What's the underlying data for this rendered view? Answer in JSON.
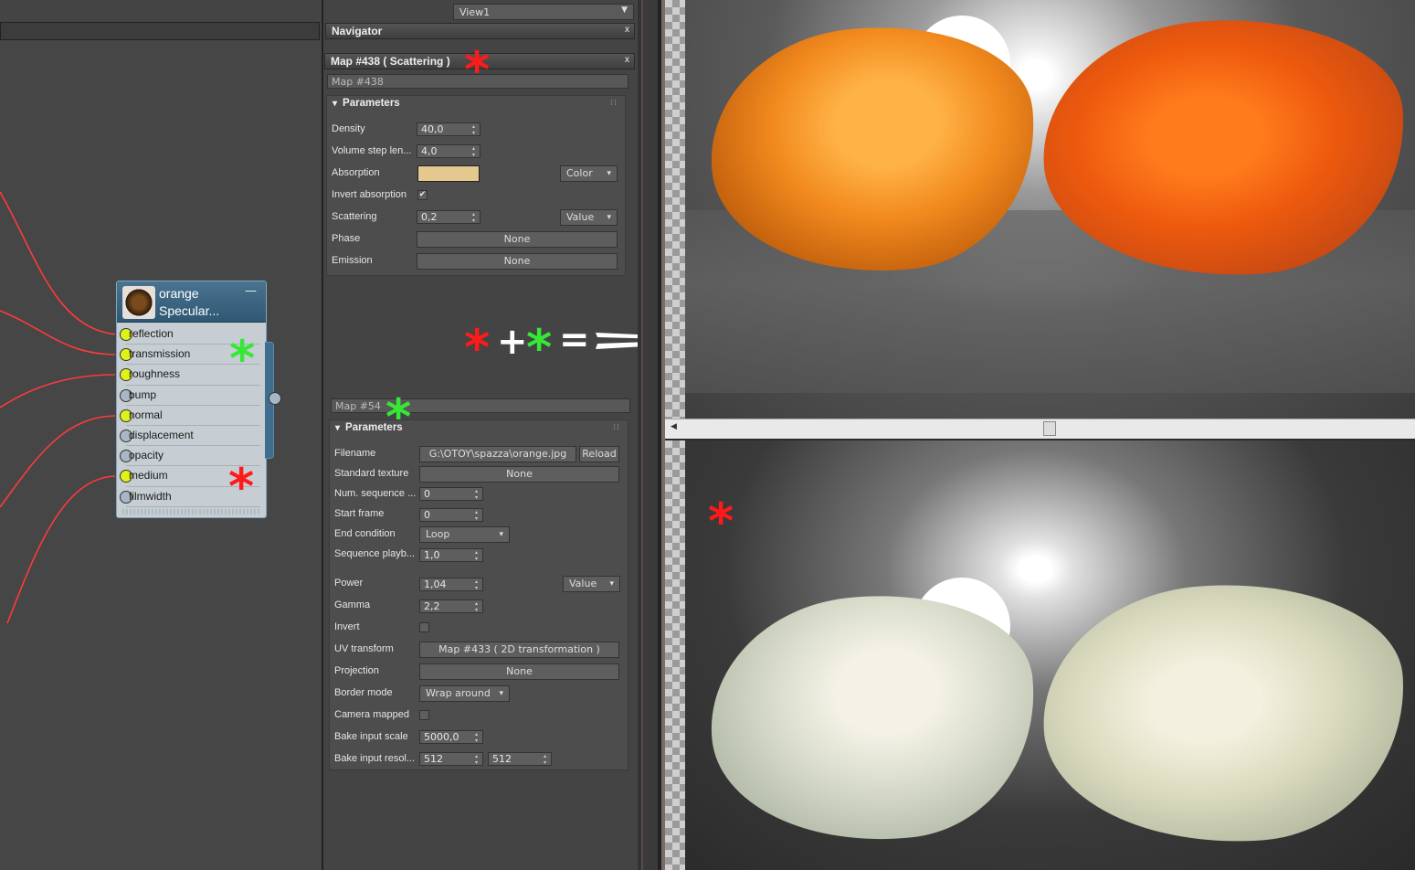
{
  "view_selector": {
    "value": "View1"
  },
  "navigator": {
    "title": "Navigator",
    "close": "x"
  },
  "scattering_panel": {
    "title": "Map #438  ( Scattering )",
    "close": "x",
    "name": "Map #438",
    "section": "Parameters",
    "params": {
      "density": {
        "label": "Density",
        "value": "40,0"
      },
      "volume_step": {
        "label": "Volume step len...",
        "value": "4,0"
      },
      "absorption": {
        "label": "Absorption",
        "color": "#e5c88e",
        "mode": "Color"
      },
      "invert_absorption": {
        "label": "Invert absorption",
        "checked": "✔"
      },
      "scattering": {
        "label": "Scattering",
        "value": "0,2",
        "mode": "Value"
      },
      "phase": {
        "label": "Phase",
        "value": "None"
      },
      "emission": {
        "label": "Emission",
        "value": "None"
      }
    }
  },
  "image_panel": {
    "name": "Map #54",
    "section": "Parameters",
    "params": {
      "filename": {
        "label": "Filename",
        "value": "G:\\OTOY\\spazza\\orange.jpg",
        "reload": "Reload"
      },
      "standard_texture": {
        "label": "Standard texture",
        "value": "None"
      },
      "num_sequence": {
        "label": "Num. sequence ...",
        "value": "0"
      },
      "start_frame": {
        "label": "Start frame",
        "value": "0"
      },
      "end_condition": {
        "label": "End condition",
        "value": "Loop"
      },
      "sequence_playback": {
        "label": "Sequence playb...",
        "value": "1,0"
      },
      "power": {
        "label": "Power",
        "value": "1,04",
        "mode": "Value"
      },
      "gamma": {
        "label": "Gamma",
        "value": "2,2"
      },
      "invert": {
        "label": "Invert"
      },
      "uv_transform": {
        "label": "UV transform",
        "value": "Map #433  ( 2D transformation )"
      },
      "projection": {
        "label": "Projection",
        "value": "None"
      },
      "border_mode": {
        "label": "Border mode",
        "value": "Wrap around"
      },
      "camera_mapped": {
        "label": "Camera mapped"
      },
      "bake_input_scale": {
        "label": "Bake input scale",
        "value": "5000,0"
      },
      "bake_input_resolution": {
        "label": "Bake input resol...",
        "x": "512",
        "y": "512"
      }
    }
  },
  "node": {
    "title_line1": "orange",
    "title_line2": "Specular...",
    "collapse": "—",
    "pins": [
      {
        "label": "reflection",
        "connected": true
      },
      {
        "label": "transmission",
        "connected": true
      },
      {
        "label": "roughness",
        "connected": true
      },
      {
        "label": "bump",
        "connected": false
      },
      {
        "label": "normal",
        "connected": true
      },
      {
        "label": "displacement",
        "connected": false
      },
      {
        "label": "opacity",
        "connected": false
      },
      {
        "label": "medium",
        "connected": true
      },
      {
        "label": "filmwidth",
        "connected": false
      }
    ]
  },
  "annotations": {
    "star": "*",
    "plus": "+",
    "equals": "="
  },
  "colors": {
    "pin_connected": "#dff21a",
    "pin_unconnected": "#a9b6c6",
    "wire": "#ff3a3a",
    "star_red": "#ff1a1a",
    "star_green": "#36e836",
    "node_header": "#3a6684"
  }
}
